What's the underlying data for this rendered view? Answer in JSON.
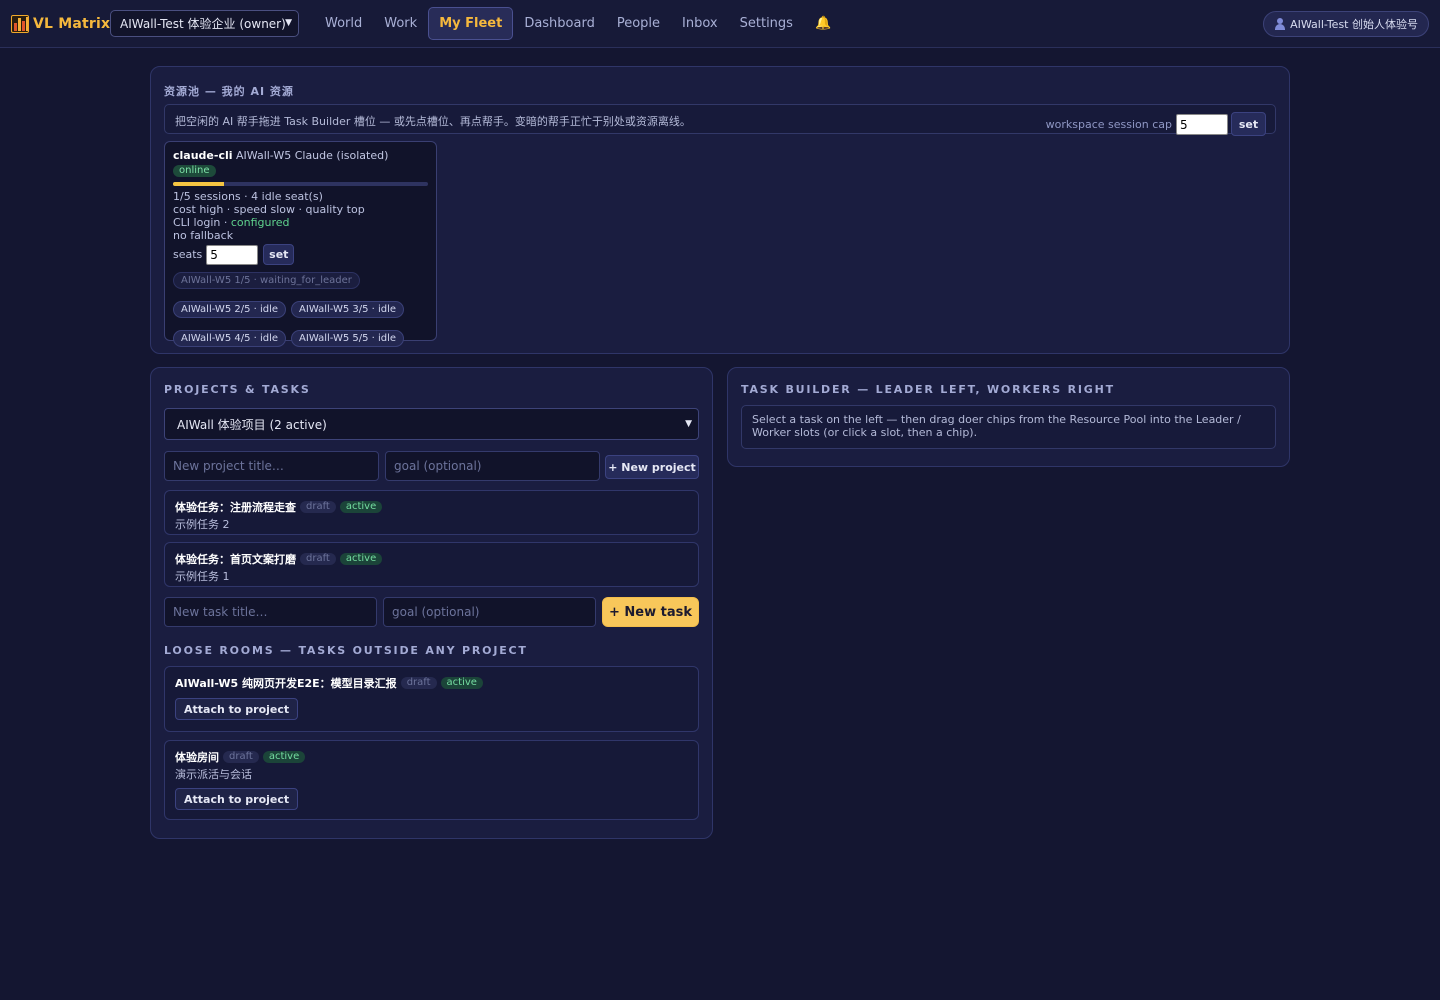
{
  "brand": {
    "name": "VL Matrix"
  },
  "workspace": {
    "selected": "AIWall-Test 体验企业 (owner)"
  },
  "nav": {
    "items": [
      "World",
      "Work",
      "My Fleet",
      "Dashboard",
      "People",
      "Inbox",
      "Settings"
    ],
    "active": "My Fleet",
    "bell": "🔔"
  },
  "user": {
    "label": "AIWall-Test 创始人体验号"
  },
  "pool": {
    "title": "资源池 — 我的 AI 资源",
    "hint": "把空闲的 AI 帮手拖进 Task Builder 槽位 — 或先点槽位、再点帮手。变暗的帮手正忙于别处或资源离线。",
    "cap_label": "workspace session cap",
    "cap_value": "5",
    "set_label": "set",
    "doer": {
      "kind": "claude-cli",
      "name": "AIWall-W5 Claude (isolated)",
      "status": "online",
      "usage_fraction": 0.2,
      "sessions": "1/5 sessions · 4 idle seat(s)",
      "profile": "cost high · speed slow · quality top",
      "cli_label": "CLI login · ",
      "cli_status": "configured",
      "fallback": "no fallback",
      "seats_label": "seats",
      "seats_value": "5",
      "set_label": "set",
      "chips": [
        {
          "label": "AIWall-W5 1/5 · waiting_for_leader",
          "busy": true
        },
        {
          "label": "AIWall-W5 2/5 · idle",
          "busy": false
        },
        {
          "label": "AIWall-W5 3/5 · idle",
          "busy": false
        },
        {
          "label": "AIWall-W5 4/5 · idle",
          "busy": false
        },
        {
          "label": "AIWall-W5 5/5 · idle",
          "busy": false
        }
      ]
    }
  },
  "projects": {
    "title": "PROJECTS & TASKS",
    "selected_project": "AIWall 体验项目 (2 active)",
    "new_project_placeholder": "New project title…",
    "goal_placeholder": "goal (optional)",
    "new_project_label": "+ New project",
    "tasks": [
      {
        "title": "体验任务：注册流程走查",
        "draft": "draft",
        "active": "active",
        "sub": "示例任务 2"
      },
      {
        "title": "体验任务：首页文案打磨",
        "draft": "draft",
        "active": "active",
        "sub": "示例任务 1"
      }
    ],
    "new_task_placeholder": "New task title…",
    "new_task_label": "+ New task",
    "loose_title": "LOOSE ROOMS — TASKS OUTSIDE ANY PROJECT",
    "loose_rooms": [
      {
        "title": "AIWall-W5 纯网页开发E2E：模型目录汇报",
        "draft": "draft",
        "active": "active",
        "sub": "",
        "attach": "Attach to project"
      },
      {
        "title": "体验房间",
        "draft": "draft",
        "active": "active",
        "sub": "演示派活与会话",
        "attach": "Attach to project"
      }
    ]
  },
  "builder": {
    "title": "TASK BUILDER — LEADER LEFT, WORKERS RIGHT",
    "hint": "Select a task on the left — then drag doer chips from the Resource Pool into the Leader / Worker slots (or click a slot, then a chip)."
  }
}
